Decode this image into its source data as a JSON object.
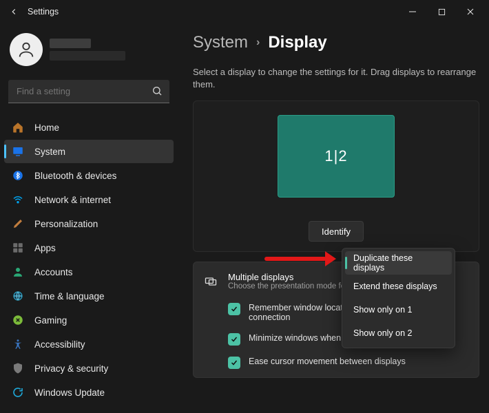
{
  "window": {
    "title": "Settings"
  },
  "search": {
    "placeholder": "Find a setting"
  },
  "sidebar": {
    "items": [
      {
        "label": "Home"
      },
      {
        "label": "System"
      },
      {
        "label": "Bluetooth & devices"
      },
      {
        "label": "Network & internet"
      },
      {
        "label": "Personalization"
      },
      {
        "label": "Apps"
      },
      {
        "label": "Accounts"
      },
      {
        "label": "Time & language"
      },
      {
        "label": "Gaming"
      },
      {
        "label": "Accessibility"
      },
      {
        "label": "Privacy & security"
      },
      {
        "label": "Windows Update"
      }
    ]
  },
  "breadcrumb": {
    "parent": "System",
    "current": "Display"
  },
  "display": {
    "hint": "Select a display to change the settings for it. Drag displays to rearrange them.",
    "monitor_label": "1|2",
    "identify": "Identify"
  },
  "multi": {
    "title": "Multiple displays",
    "sub": "Choose the presentation mode for y",
    "chk1": "Remember window location",
    "chk1b": "connection",
    "chk2": "Minimize windows when a monitor is disconnected",
    "chk3": "Ease cursor movement between displays"
  },
  "popup": {
    "o1": "Duplicate these displays",
    "o2": "Extend these displays",
    "o3": "Show only on 1",
    "o4": "Show only on 2"
  }
}
